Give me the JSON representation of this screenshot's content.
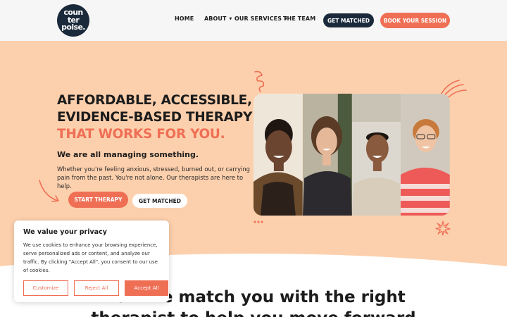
{
  "header": {
    "logo_lines": [
      "coun",
      "ter",
      "poise."
    ],
    "nav": [
      {
        "label": "HOME"
      },
      {
        "label": "ABOUT"
      },
      {
        "label": "OUR SERVICES"
      },
      {
        "label": "THE TEAM"
      }
    ],
    "get_matched_label": "GET MATCHED",
    "book_label": "BOOK YOUR SESSION"
  },
  "hero": {
    "headline_lines": [
      "AFFORDABLE, ACCESSIBLE,",
      "EVIDENCE-BASED THERAPY",
      "THAT WORKS FOR YOU."
    ],
    "subheading": "We are all managing something.",
    "description": "Whether you're feeling anxious, stressed, burned out, or carrying pain from the past. You're not alone. Our therapists are here to help.",
    "start_label": "START THERAPY",
    "match_label": "GET MATCHED"
  },
  "cookie": {
    "title": "We value your privacy",
    "body": "We use cookies to enhance your browsing experience, serve personalized ads or content, and analyze our traffic. By clicking \"Accept All\", you consent to our use of cookies.",
    "customize_label": "Customize",
    "reject_label": "Reject All",
    "accept_label": "Accept All"
  },
  "section": {
    "heading_lines": [
      "How we match you with the right",
      "therapist to help you move forward"
    ]
  },
  "colors": {
    "accent": "#ef6f55",
    "navy": "#1b2a3b",
    "hero_bg": "#fdd0ad"
  }
}
